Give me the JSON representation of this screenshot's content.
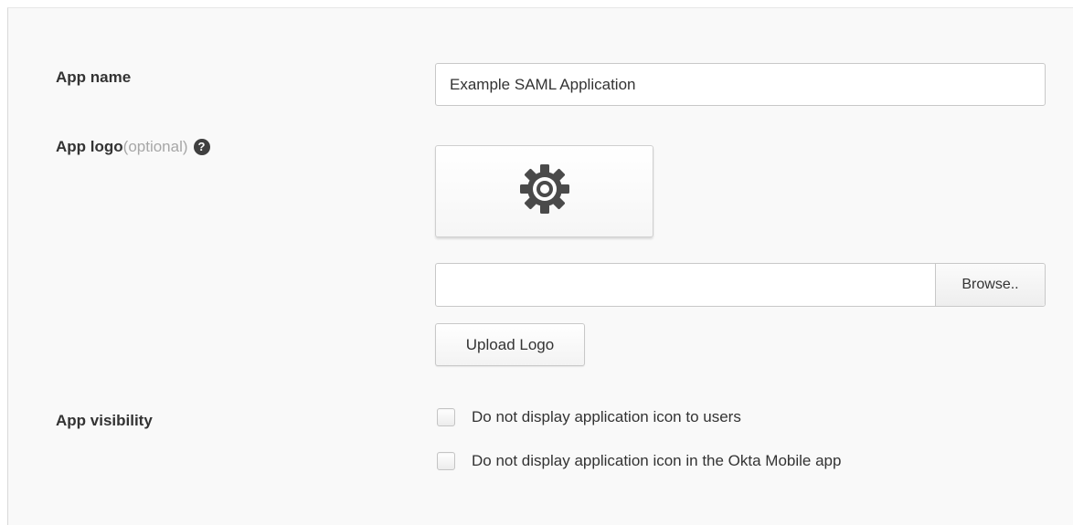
{
  "form": {
    "app_name": {
      "label": "App name",
      "value": "Example SAML Application"
    },
    "app_logo": {
      "label": "App logo",
      "optional_label": "(optional)",
      "help_icon": "?",
      "preview_icon": "gear-icon",
      "file_path": "",
      "browse_label": "Browse..",
      "upload_label": "Upload Logo"
    },
    "app_visibility": {
      "label": "App visibility",
      "options": [
        {
          "label": "Do not display application icon to users",
          "checked": false
        },
        {
          "label": "Do not display application icon in the Okta Mobile app",
          "checked": false
        }
      ]
    }
  },
  "colors": {
    "panel_bg": "#f9f9f9",
    "text": "#333333",
    "muted": "#a7a7a7",
    "icon": "#4a4a4a"
  }
}
